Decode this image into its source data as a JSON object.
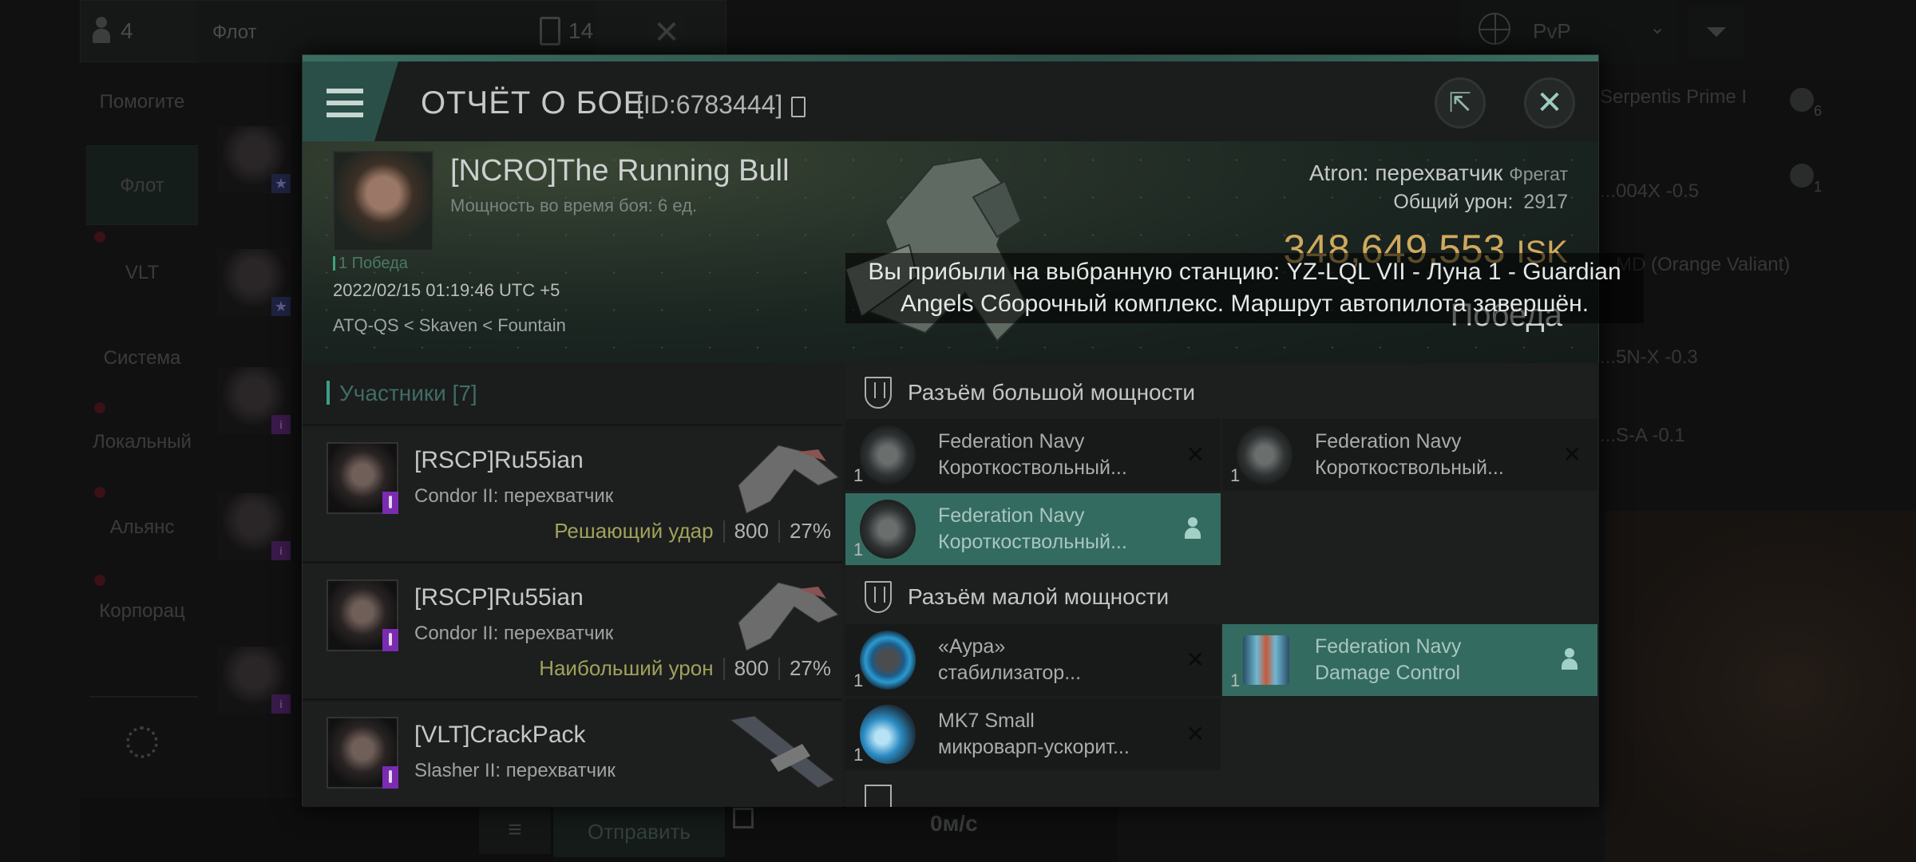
{
  "background": {
    "top_bar": {
      "user_count": "4",
      "channel_tab": "Флот",
      "message_count": "14"
    },
    "sidebar": {
      "items": [
        {
          "label": "Помогите",
          "active": false,
          "unread": false
        },
        {
          "label": "Флот",
          "active": true,
          "unread": true
        },
        {
          "label": "VLT",
          "active": false,
          "unread": false
        },
        {
          "label": "Система",
          "active": false,
          "unread": true
        },
        {
          "label": "Локальный",
          "active": false,
          "unread": true
        },
        {
          "label": "Альянс",
          "active": false,
          "unread": true
        },
        {
          "label": "Корпорац",
          "active": false,
          "unread": false
        }
      ],
      "settings_icon": "gear-icon"
    },
    "overview": {
      "filter_label": "PvP",
      "locations": [
        "Serpentis Prime I",
        "...004X -0.5",
        "...MD (Orange Valiant)",
        "...5N-X -0.3",
        "...S-A -0.1"
      ],
      "counts": [
        "6",
        "1"
      ]
    },
    "chat_input": {
      "send_label": "Отправить"
    },
    "speed": "0м/с"
  },
  "report": {
    "title": "ОТЧЁТ О БОЕ",
    "report_id": "[ID:6783444]",
    "victim": {
      "name": "[NCRO]The Running Bull",
      "power_line": "Мощность во время боя: 6 ед.",
      "wins": "1 Победа",
      "datetime": "2022/02/15 01:19:46 UTC +5",
      "location": "ATQ-QS < Skaven < Fountain",
      "ship": "Atron: перехватчик",
      "ship_class": "Фрегат",
      "total_damage_label": "Общий урон:",
      "total_damage": "2917",
      "isk_value": "348,649,553",
      "isk_currency": "ISK",
      "result": "Победа"
    },
    "notification": "Вы прибыли на выбранную станцию: YZ-LQL VII - Луна 1 - Guardian Angels Сборочный комплекс. Маршрут автопилота завершён.",
    "participants": {
      "header": "Участники",
      "count": "[7]",
      "rows": [
        {
          "name": "[RSCP]Ru55ian",
          "ship": "Condor II: перехватчик",
          "role": "Решающий удар",
          "damage": "800",
          "percent": "27%"
        },
        {
          "name": "[RSCP]Ru55ian",
          "ship": "Condor II: перехватчик",
          "role": "Наибольший урон",
          "damage": "800",
          "percent": "27%"
        },
        {
          "name": "[VLT]CrackPack",
          "ship": "Slasher II: перехватчик",
          "role": "",
          "damage": "",
          "percent": ""
        }
      ]
    },
    "fittings": {
      "high_slots": {
        "title": "Разъём большой мощности",
        "modules": [
          {
            "line1": "Federation Navy",
            "line2": "Короткоствольный...",
            "qty": "1",
            "status": "destroyed",
            "highlight": false
          },
          {
            "line1": "Federation Navy",
            "line2": "Короткоствольный...",
            "qty": "1",
            "status": "destroyed",
            "highlight": false
          },
          {
            "line1": "Federation Navy",
            "line2": "Короткоствольный...",
            "qty": "1",
            "status": "dropped",
            "highlight": true
          }
        ]
      },
      "low_slots": {
        "title": "Разъём малой мощности",
        "modules": [
          {
            "line1": "«Аура»",
            "line2": "стабилизатор...",
            "qty": "1",
            "status": "destroyed",
            "highlight": false
          },
          {
            "line1": "Federation Navy",
            "line2": "Damage Control",
            "qty": "1",
            "status": "dropped",
            "highlight": true
          },
          {
            "line1": "MK7 Small",
            "line2": "микроварп-ускорит...",
            "qty": "1",
            "status": "destroyed",
            "highlight": false
          }
        ]
      }
    }
  }
}
